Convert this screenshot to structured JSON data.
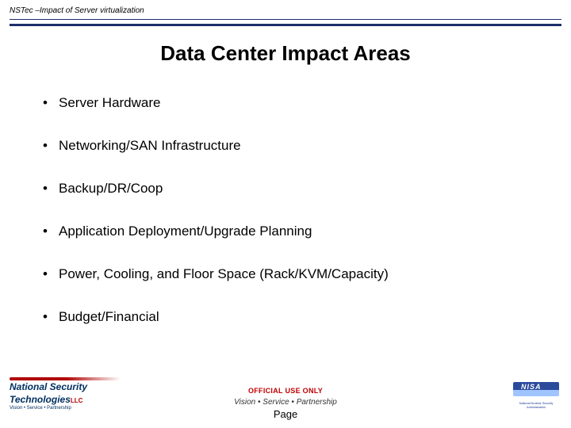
{
  "header": {
    "label": "NSTec –Impact of Server virtualization"
  },
  "title": "Data Center Impact Areas",
  "bullets": [
    "Server Hardware",
    "Networking/SAN Infrastructure",
    "Backup/DR/Coop",
    "Application Deployment/Upgrade Planning",
    "Power, Cooling, and Floor Space (Rack/KVM/Capacity)",
    "Budget/Financial"
  ],
  "footer": {
    "official": "OFFICIAL USE ONLY",
    "tagline": "Vision • Service • Partnership",
    "page": "Page"
  },
  "logos": {
    "left_main": "National Security Technologies",
    "left_suffix": "LLC",
    "left_sub": "Vision • Service • Partnership",
    "right_sub": "National Nuclear Security Administration"
  }
}
